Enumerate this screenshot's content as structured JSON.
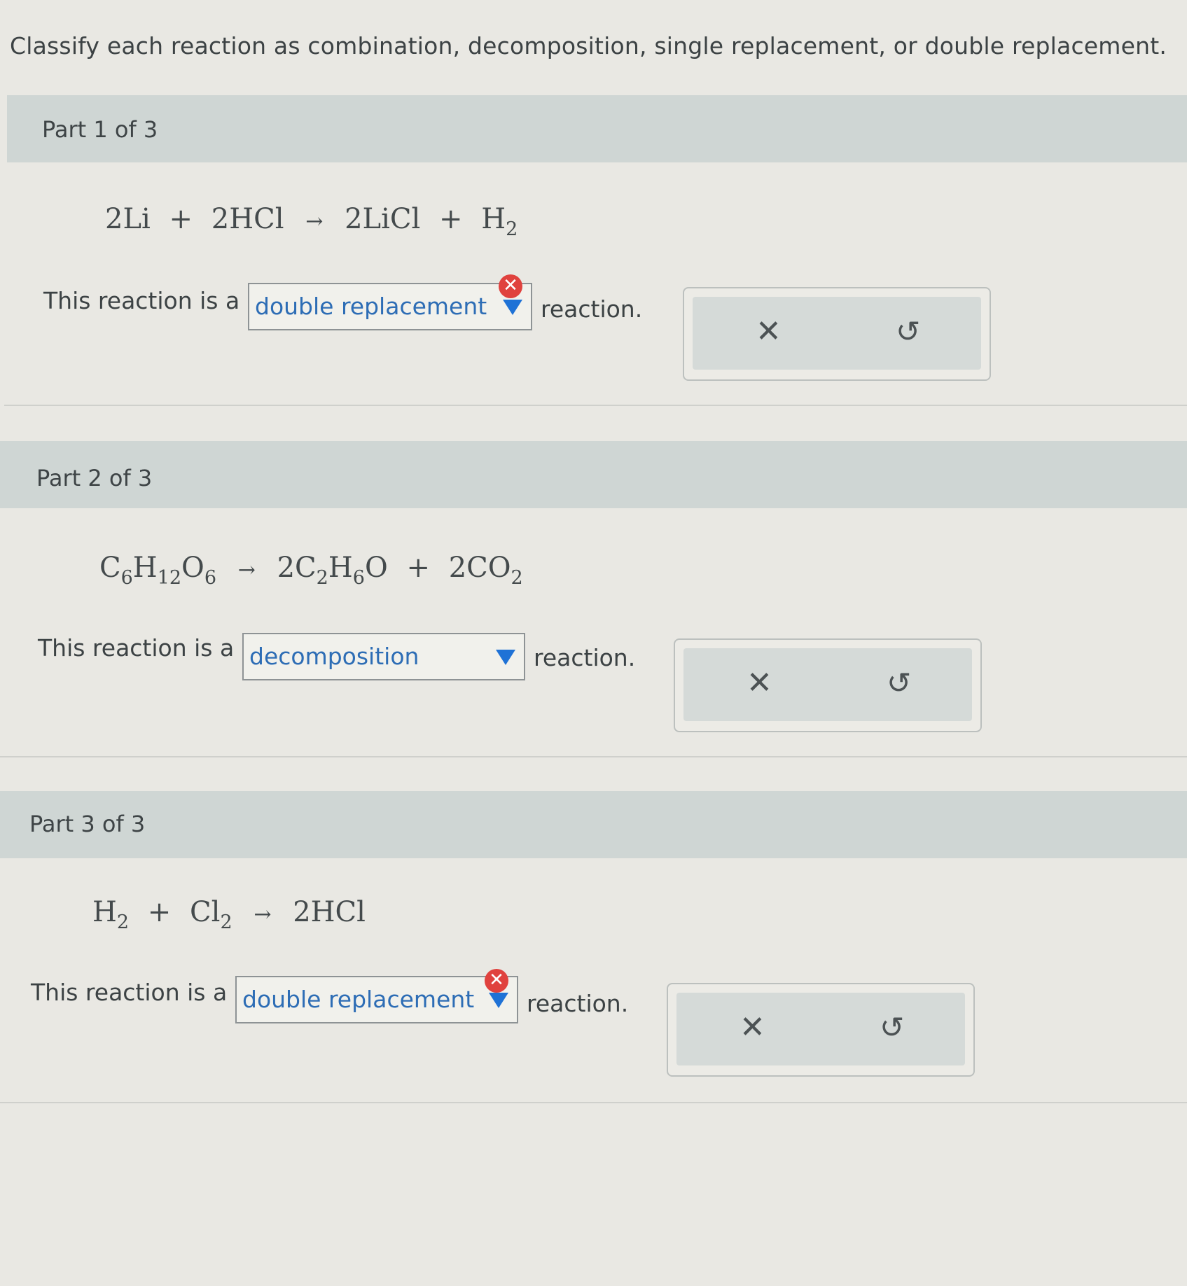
{
  "instructions": "Classify each reaction as combination, decomposition, single replacement, or double replacement.",
  "parts": [
    {
      "title": "Part 1 of 3",
      "equation": {
        "lhs": [
          [
            "2Li",
            ""
          ],
          [
            "2HCl",
            ""
          ]
        ],
        "rhs": [
          [
            "2LiCl",
            ""
          ],
          [
            "H",
            "2"
          ]
        ]
      },
      "prefix": "This reaction is a",
      "answer": "double replacement",
      "suffix": "reaction.",
      "incorrect": true
    },
    {
      "title": "Part 2 of 3",
      "prefix": "This reaction is a",
      "answer": "decomposition",
      "suffix": "reaction.",
      "incorrect": false
    },
    {
      "title": "Part 3 of 3",
      "prefix": "This reaction is a",
      "answer": "double replacement",
      "suffix": "reaction.",
      "incorrect": true
    }
  ],
  "equations": {
    "p1": {
      "a": "2Li",
      "plus": "+",
      "b": "2HCl",
      "arrow": "→",
      "c": "2LiCl",
      "d": "H",
      "d_sub": "2"
    },
    "p2": {
      "a": "C",
      "a_sub1": "6",
      "a2": "H",
      "a_sub2": "12",
      "a3": "O",
      "a_sub3": "6",
      "arrow": "→",
      "b": "2C",
      "b_sub1": "2",
      "b2": "H",
      "b_sub2": "6",
      "b3": "O",
      "plus": "+",
      "c": "2CO",
      "c_sub": "2"
    },
    "p3": {
      "a": "H",
      "a_sub": "2",
      "plus": "+",
      "b": "Cl",
      "b_sub": "2",
      "arrow": "→",
      "c": "2HCl"
    }
  },
  "icons": {
    "error": "✕",
    "clear": "✕",
    "undo": "↺"
  },
  "colors": {
    "answer_text": "#2d6db5",
    "caret": "#1f72d6",
    "error_badge": "#e0423e",
    "header_band": "#cfd6d4"
  }
}
